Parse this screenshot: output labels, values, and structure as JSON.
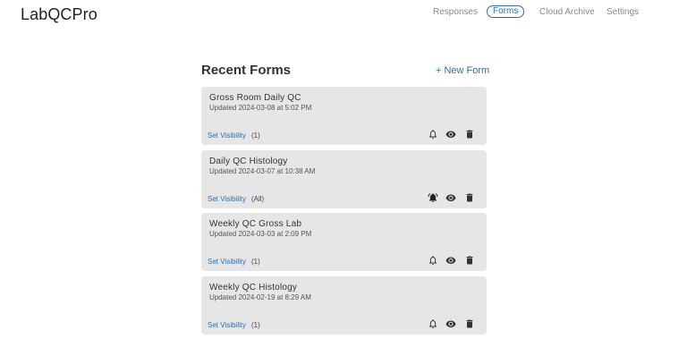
{
  "app": {
    "name": "LabQCPro"
  },
  "nav": {
    "items": [
      {
        "label": "Responses",
        "active": false
      },
      {
        "label": "Forms",
        "active": true
      },
      {
        "label": "Cloud Archive",
        "active": false
      },
      {
        "label": "Settings",
        "active": false
      }
    ]
  },
  "main": {
    "title": "Recent Forms",
    "new_form_label": "+ New Form",
    "forms": [
      {
        "title": "Gross Room Daily QC",
        "updated": "Updated 2024-03-08 at 5:02 PM",
        "visibility_label": "Set Visibility",
        "audience": "(1)",
        "notification": "off"
      },
      {
        "title": "Daily QC Histology",
        "updated": "Updated 2024-03-07 at 10:38 AM",
        "visibility_label": "Set Visibility",
        "audience": "(All)",
        "notification": "on"
      },
      {
        "title": "Weekly QC Gross Lab",
        "updated": "Updated 2024-03-03 at 2:09 PM",
        "visibility_label": "Set Visibility",
        "audience": "(1)",
        "notification": "off"
      },
      {
        "title": "Weekly QC Histology",
        "updated": "Updated 2024-02-19 at 8:29 AM",
        "visibility_label": "Set Visibility",
        "audience": "(1)",
        "notification": "off"
      }
    ],
    "icons": [
      "bell-icon",
      "eye-icon",
      "trash-icon"
    ]
  },
  "colors": {
    "accent": "#2f6fa3",
    "card_bg": "#e6e6e6",
    "icon": "#333333"
  }
}
